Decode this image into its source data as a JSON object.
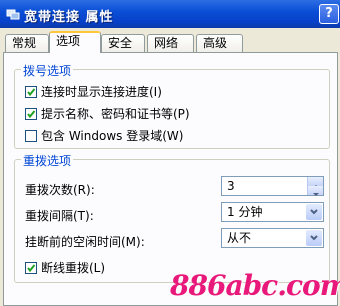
{
  "window": {
    "title": "宽带连接  属性",
    "help_label": "?"
  },
  "tabs": [
    "常规",
    "选项",
    "安全",
    "网络",
    "高级"
  ],
  "dial_group": {
    "title": "拨号选项",
    "options": [
      {
        "label": "连接时显示连接进度(I)",
        "checked": true
      },
      {
        "label": "提示名称、密码和证书等(P)",
        "checked": true
      },
      {
        "label": "包含 Windows 登录域(W)",
        "checked": false
      }
    ]
  },
  "redial_group": {
    "title": "重拨选项",
    "attempts_label": "重拨次数(R):",
    "attempts_value": "3",
    "interval_label": "重拨间隔(T):",
    "interval_value": "1 分钟",
    "idle_label": "挂断前的空闲时间(M):",
    "idle_value": "从不",
    "redial_on_drop_label": "断线重拨(L)",
    "redial_on_drop_checked": true
  },
  "watermark": "886abc.com",
  "colors": {
    "title_bar": "#0a4fd6",
    "group_title": "#0046d5",
    "watermark": "#e8197a"
  }
}
